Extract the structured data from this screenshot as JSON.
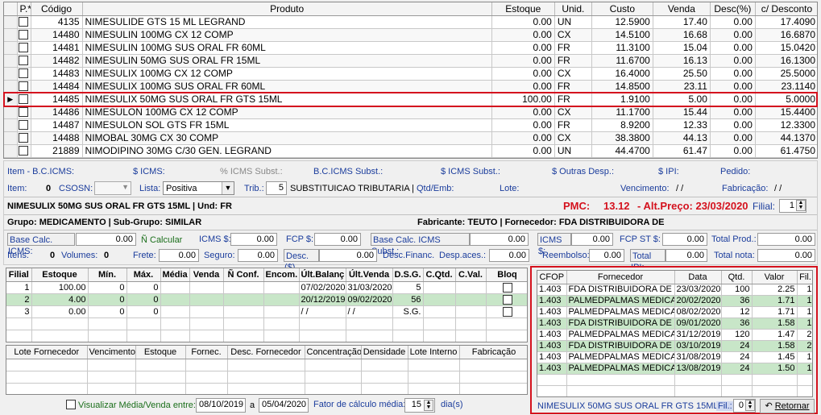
{
  "grid": {
    "headers": [
      "P.*",
      "Código",
      "Produto",
      "Estoque",
      "Unid.",
      "Custo",
      "Venda",
      "Desc(%)",
      "c/ Desconto"
    ],
    "rows": [
      {
        "code": "4135",
        "product": "NIMESULIDE GTS 15 ML LEGRAND",
        "stock": "0.00",
        "unit": "UN",
        "cost": "12.5900",
        "sale": "17.40",
        "disc": "0.00",
        "withdisc": "17.4090"
      },
      {
        "code": "14480",
        "product": "NIMESULIN 100MG CX 12 COMP",
        "stock": "0.00",
        "unit": "CX",
        "cost": "14.5100",
        "sale": "16.68",
        "disc": "0.00",
        "withdisc": "16.6870"
      },
      {
        "code": "14481",
        "product": "NIMESULIN 100MG SUS ORAL FR 60ML",
        "stock": "0.00",
        "unit": "FR",
        "cost": "11.3100",
        "sale": "15.04",
        "disc": "0.00",
        "withdisc": "15.0420"
      },
      {
        "code": "14482",
        "product": "NIMESULIN 50MG SUS ORAL FR 15ML",
        "stock": "0.00",
        "unit": "FR",
        "cost": "11.6700",
        "sale": "16.13",
        "disc": "0.00",
        "withdisc": "16.1300"
      },
      {
        "code": "14483",
        "product": "NIMESULIX 100MG CX 12 COMP",
        "stock": "0.00",
        "unit": "CX",
        "cost": "16.4000",
        "sale": "25.50",
        "disc": "0.00",
        "withdisc": "25.5000"
      },
      {
        "code": "14484",
        "product": "NIMESULIX 100MG SUS ORAL FR 60ML",
        "stock": "0.00",
        "unit": "FR",
        "cost": "14.8500",
        "sale": "23.11",
        "disc": "0.00",
        "withdisc": "23.1140"
      },
      {
        "code": "14485",
        "product": "NIMESULIX 50MG SUS ORAL FR GTS 15ML",
        "stock": "100.00",
        "unit": "FR",
        "cost": "1.9100",
        "sale": "5.00",
        "disc": "0.00",
        "withdisc": "5.0000",
        "selected": true
      },
      {
        "code": "14486",
        "product": "NIMESULON 100MG CX 12 COMP",
        "stock": "0.00",
        "unit": "CX",
        "cost": "11.1700",
        "sale": "15.44",
        "disc": "0.00",
        "withdisc": "15.4400"
      },
      {
        "code": "14487",
        "product": "NIMESULON SOL GTS FR 15ML",
        "stock": "0.00",
        "unit": "FR",
        "cost": "8.9200",
        "sale": "12.33",
        "disc": "0.00",
        "withdisc": "12.3300"
      },
      {
        "code": "14488",
        "product": "NIMOBAL 30MG CX 30 COMP",
        "stock": "0.00",
        "unit": "CX",
        "cost": "38.3800",
        "sale": "44.13",
        "disc": "0.00",
        "withdisc": "44.1370"
      },
      {
        "code": "21889",
        "product": "NIMODIPINO 30MG C/30 GEN. LEGRAND",
        "stock": "0.00",
        "unit": "UN",
        "cost": "44.4700",
        "sale": "61.47",
        "disc": "0.00",
        "withdisc": "61.4750"
      }
    ]
  },
  "info": {
    "row1": [
      "Item - B.C.ICMS:",
      "$ ICMS:",
      "% ICMS Subst.:",
      "B.C.ICMS Subst.:",
      "$ ICMS Subst.:",
      "$ Outras Desp.:",
      "$ IPI:",
      "Pedido:"
    ],
    "item_label": "Item:",
    "item_value": "0",
    "csosn_label": "CSOSN:",
    "lista_label": "Lista:",
    "lista_value": "Positiva",
    "trib_label": "Trib.:",
    "trib_value": "5",
    "trib_desc": "SUBSTITUICAO TRIBUTARIA |",
    "qtd_label": "Qtd/Emb:",
    "lote_label": "Lote:",
    "venc_label": "Vencimento:",
    "venc_value": "/ /",
    "fab_label": "Fabricação:",
    "fab_value": "/ /",
    "product_line": "NIMESULIX 50MG SUS ORAL FR GTS 15ML | Und: FR",
    "pmc_label": "PMC:",
    "pmc_value": "13.12",
    "alt_text": "- Alt.Preço: 23/03/2020",
    "filial_label": "Filial:",
    "filial_value": "1",
    "group_line": "Grupo: MEDICAMENTO | Sub-Grupo: SIMILAR",
    "maker_line": "Fabricante: TEUTO |  Fornecedor: FDA DISTRIBUIDORA DE",
    "base_icms_label": "Base Calc. ICMS:",
    "base_icms": "0.00",
    "n_calcular": "Ñ Calcular",
    "icms_label": "ICMS $:",
    "icms": "0.00",
    "fcp_label": "FCP $:",
    "fcp": "0.00",
    "base_icms_st_label": "Base Calc. ICMS Subst.:",
    "base_icms_st": "0.00",
    "icms_st_label": "ICMS $:",
    "icms_st": "0.00",
    "fcp_st_label": "FCP ST $:",
    "fcp_st": "0.00",
    "total_prod_label": "Total Prod.:",
    "total_prod": "0.00",
    "itens_label": "Itens:",
    "itens": "0",
    "volumes_label": "Volumes:",
    "volumes": "0",
    "frete_label": "Frete:",
    "frete": "0.00",
    "seguro_label": "Seguro:",
    "seguro": "0.00",
    "desc_label": "Desc.($)",
    "desc": "0.00",
    "desc_fin_label": "Desc.Financ.",
    "desp_label": "Desp.aces.:",
    "desp": "0.00",
    "reemb_label": "Reembolso:",
    "reemb": "0.00",
    "total_ipi_label": "Total IPI:",
    "total_ipi": "0.00",
    "total_nota_label": "Total nota:",
    "total_nota": "0.00"
  },
  "filial_grid": {
    "headers": [
      "Filial",
      "Estoque",
      "Mín.",
      "Máx.",
      "Média",
      "Venda",
      "Ñ Conf.",
      "Encom.",
      "Últ.Balanç",
      "Últ.Venda",
      "D.S.G.",
      "C.Qtd.",
      "C.Val.",
      "Bloq"
    ],
    "rows": [
      {
        "filial": "1",
        "estoque": "100.00",
        "min": "0",
        "max": "0",
        "balanc": "07/02/2020",
        "venda": "31/03/2020",
        "dsg": "5"
      },
      {
        "filial": "2",
        "estoque": "4.00",
        "min": "0",
        "max": "0",
        "balanc": "20/12/2019",
        "venda": "09/02/2020",
        "dsg": "56"
      },
      {
        "filial": "3",
        "estoque": "0.00",
        "min": "0",
        "max": "0",
        "balanc": "/ /",
        "venda": "/ /",
        "dsg": "S.G."
      }
    ]
  },
  "lote_grid": {
    "headers": [
      "Lote Fornecedor",
      "Vencimento",
      "Estoque",
      "Fornec.",
      "Desc. Fornecedor",
      "Concentração",
      "Densidade",
      "Lote Interno",
      "Fabricação"
    ]
  },
  "footer": {
    "visualizar_label": "Visualizar Média/Venda entre:",
    "date_from": "08/10/2019",
    "a_label": "a",
    "date_to": "05/04/2020",
    "fator_label": "Fator de cálculo média:",
    "fator_value": "15",
    "dias_label": "dia(s)"
  },
  "compras": {
    "headers": [
      "CFOP",
      "Fornecedor",
      "Data",
      "Qtd.",
      "Valor",
      "Fil."
    ],
    "rows": [
      {
        "cfop": "1.403",
        "forn": "FDA DISTRIBUIDORA DE ME",
        "data": "23/03/2020",
        "qtd": "100",
        "valor": "2.25",
        "fil": "1"
      },
      {
        "cfop": "1.403",
        "forn": "PALMEDPALMAS MEDICAM",
        "data": "20/02/2020",
        "qtd": "36",
        "valor": "1.71",
        "fil": "1"
      },
      {
        "cfop": "1.403",
        "forn": "PALMEDPALMAS MEDICAM",
        "data": "08/02/2020",
        "qtd": "12",
        "valor": "1.71",
        "fil": "1"
      },
      {
        "cfop": "1.403",
        "forn": "FDA DISTRIBUIDORA DE ME",
        "data": "09/01/2020",
        "qtd": "36",
        "valor": "1.58",
        "fil": "1"
      },
      {
        "cfop": "1.403",
        "forn": "PALMEDPALMAS MEDICAM",
        "data": "31/12/2019",
        "qtd": "120",
        "valor": "1.47",
        "fil": "2"
      },
      {
        "cfop": "1.403",
        "forn": "FDA DISTRIBUIDORA DE ME",
        "data": "03/10/2019",
        "qtd": "24",
        "valor": "1.58",
        "fil": "2"
      },
      {
        "cfop": "1.403",
        "forn": "PALMEDPALMAS MEDICAM",
        "data": "31/08/2019",
        "qtd": "24",
        "valor": "1.45",
        "fil": "1"
      },
      {
        "cfop": "1.403",
        "forn": "PALMEDPALMAS MEDICAM",
        "data": "13/08/2019",
        "qtd": "24",
        "valor": "1.50",
        "fil": "1"
      }
    ],
    "product_label": "NIMESULIX 50MG SUS ORAL FR GTS 15ML",
    "fil_label": "Fil.:",
    "fil_value": "0",
    "retornar_label": "Retornar"
  },
  "colors": {
    "accent_red": "#d4121e",
    "label_blue": "#1a3c9c",
    "row_green": "#c8e6c8"
  }
}
